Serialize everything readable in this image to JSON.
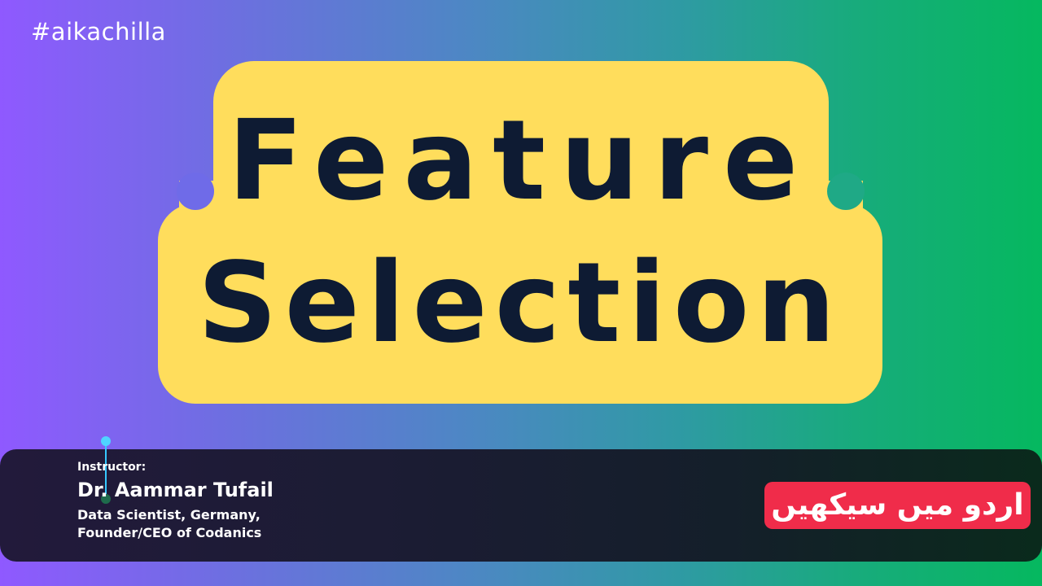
{
  "hashtag": "#aikachilla",
  "title": {
    "line1": "Feature",
    "line2": "Selection"
  },
  "instructor": {
    "label": "Instructor:",
    "name": "Dr. Aammar Tufail",
    "role_line1": "Data Scientist, Germany,",
    "role_line2": "Founder/CEO of Codanics"
  },
  "urdu_badge": "اردو میں سیکھیں",
  "colors": {
    "title_badge": "#ffdd5c",
    "title_text": "#0e1b33",
    "urdu_badge": "#f02c4a",
    "accent_pin": "#36c7ff"
  }
}
